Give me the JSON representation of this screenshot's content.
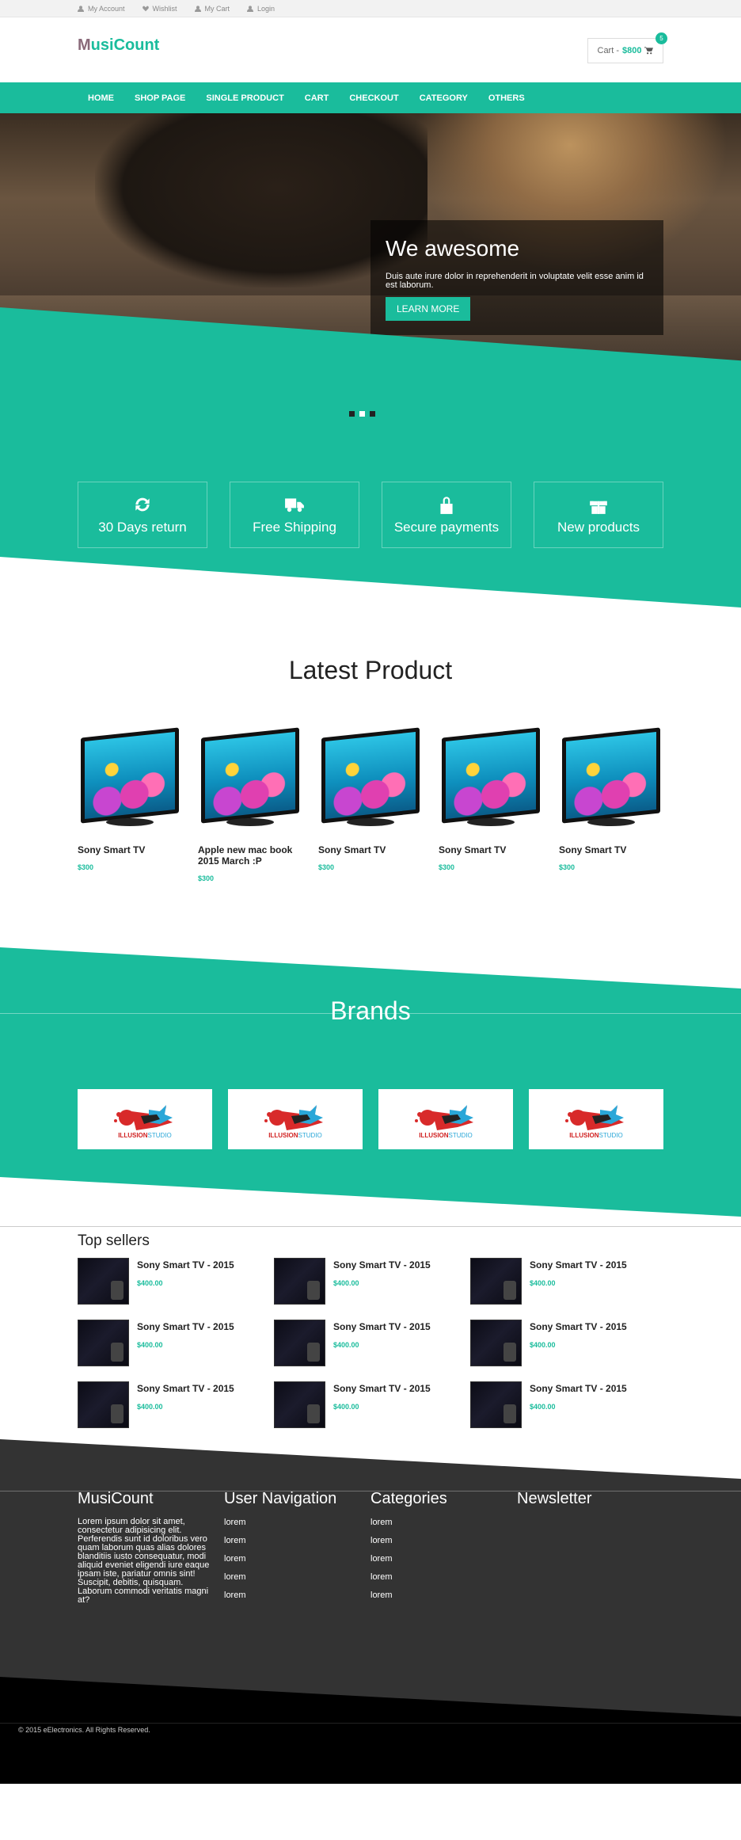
{
  "topbar": {
    "items": [
      "My Account",
      "Wishlist",
      "My Cart",
      "Login"
    ]
  },
  "header": {
    "logo_first": "M",
    "logo_rest": "usiCount",
    "cart_label": "Cart -",
    "cart_amount": "$800",
    "cart_count": "5"
  },
  "nav": {
    "items": [
      "HOME",
      "SHOP PAGE",
      "SINGLE PRODUCT",
      "CART",
      "CHECKOUT",
      "CATEGORY",
      "OTHERS"
    ]
  },
  "hero": {
    "title": "We awesome",
    "text": "Duis aute irure dolor in reprehenderit in voluptate velit esse anim id est laborum.",
    "button": "LEARN MORE"
  },
  "features": {
    "items": [
      {
        "icon": "refresh-icon",
        "label": "30 Days return"
      },
      {
        "icon": "truck-icon",
        "label": "Free Shipping"
      },
      {
        "icon": "lock-icon",
        "label": "Secure payments"
      },
      {
        "icon": "gift-icon",
        "label": "New products"
      }
    ]
  },
  "latest": {
    "title": "Latest Product",
    "products": [
      {
        "name": "Sony Smart TV",
        "price": "$300"
      },
      {
        "name": "Apple new mac book 2015 March :P",
        "price": "$300"
      },
      {
        "name": "Sony Smart TV",
        "price": "$300"
      },
      {
        "name": "Sony Smart TV",
        "price": "$300"
      },
      {
        "name": "Sony Smart TV",
        "price": "$300"
      }
    ]
  },
  "brands": {
    "title": "Brands",
    "logo_red": "ILLUSION",
    "logo_blue": "STUDIO",
    "count": 4
  },
  "sellers": {
    "title": "Top sellers",
    "items": [
      {
        "name": "Sony Smart TV - 2015",
        "price": "$400.00"
      },
      {
        "name": "Sony Smart TV - 2015",
        "price": "$400.00"
      },
      {
        "name": "Sony Smart TV - 2015",
        "price": "$400.00"
      },
      {
        "name": "Sony Smart TV - 2015",
        "price": "$400.00"
      },
      {
        "name": "Sony Smart TV - 2015",
        "price": "$400.00"
      },
      {
        "name": "Sony Smart TV - 2015",
        "price": "$400.00"
      },
      {
        "name": "Sony Smart TV - 2015",
        "price": "$400.00"
      },
      {
        "name": "Sony Smart TV - 2015",
        "price": "$400.00"
      },
      {
        "name": "Sony Smart TV - 2015",
        "price": "$400.00"
      }
    ]
  },
  "footer": {
    "about_title": "MusiCount",
    "about_text": "Lorem ipsum dolor sit amet, consectetur adipisicing elit. Perferendis sunt id doloribus vero quam laborum quas alias dolores blanditiis iusto consequatur, modi aliquid eveniet eligendi iure eaque ipsam iste, pariatur omnis sint! Suscipit, debitis, quisquam. Laborum commodi veritatis magni at?",
    "nav_title": "User Navigation",
    "nav_links": [
      "lorem",
      "lorem",
      "lorem",
      "lorem",
      "lorem"
    ],
    "cat_title": "Categories",
    "cat_links": [
      "lorem",
      "lorem",
      "lorem",
      "lorem",
      "lorem"
    ],
    "news_title": "Newsletter"
  },
  "copyright": "© 2015 eElectronics. All Rights Reserved.",
  "colors": {
    "accent": "#1abc9c",
    "footer": "#333333",
    "bottom": "#000000"
  }
}
